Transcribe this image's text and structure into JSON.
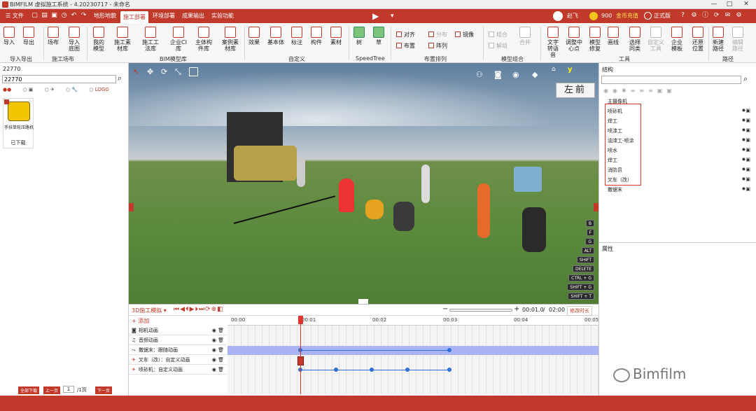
{
  "window": {
    "title": "BIMFILM 虚拟施工系统 - 4.20230717 - 未命名",
    "min": "—",
    "max": "□",
    "close": "✕"
  },
  "menu": {
    "file": "文件",
    "tabs": [
      "地形地貌",
      "施工部署",
      "环境部署",
      "成果输出",
      "实验功能"
    ],
    "active": "施工部署",
    "user": "赵飞",
    "coins": "900",
    "recharge": "金币充值",
    "edition": "正式版"
  },
  "ribbon": {
    "buttons": [
      "导入",
      "导出",
      "场布",
      "导入底图",
      "我的模型",
      "施工素材库",
      "施工工法库",
      "企业CI库",
      "主体构件库",
      "案例素材库",
      "效果",
      "基本体",
      "标注",
      "构件",
      "素材",
      "树",
      "草",
      "镜像",
      "文字转语音",
      "调整中心点",
      "模型修复",
      "画线",
      "选择同类",
      "自定义工具",
      "企业模板",
      "还原位置",
      "新建路径",
      "编辑路径"
    ],
    "small": [
      "对齐",
      "分布",
      "布置",
      "阵列",
      "组合",
      "合并",
      "解组"
    ],
    "groups": [
      "导入导出",
      "施工场布",
      "BIM模型库",
      "自定义",
      "SpeedTree",
      "布置排列",
      "模型组合",
      "工具",
      "路径"
    ]
  },
  "left": {
    "header": "22770",
    "search_value": "22770",
    "tab_logo": "LOGO",
    "item": {
      "name": "手扶单轮压路机",
      "status": "已下载"
    },
    "pager": {
      "first": "全部下载",
      "prev": "上一页",
      "page": "1",
      "total": "/1页",
      "next": "下一页"
    }
  },
  "viewport": {
    "view_labels": [
      "左",
      "前"
    ],
    "axis": "y",
    "shortcuts": [
      "B",
      "F",
      "G",
      "ALT",
      "SHIFT",
      "DELETE",
      "CTRL + G",
      "SHIFT + G",
      "SHIFT + T"
    ]
  },
  "right": {
    "structure_title": "结构",
    "root": "主摄像机",
    "items": [
      "喷砂机",
      "焊工",
      "喷漆工",
      "油漆工-喷涂",
      "喷水",
      "焊工",
      "消防员",
      "叉车（改）",
      "撒锯末"
    ],
    "properties_title": "属性"
  },
  "timeline": {
    "mode": "3D施工模拟",
    "time": "00:01.0",
    "duration": "02:00",
    "modify": "修改时长",
    "add": "添加",
    "ticks": [
      "00:00",
      "00:01",
      "00:02",
      "00:03",
      "00:04",
      "00:05"
    ],
    "tracks": [
      {
        "icon": "camera-icon",
        "label": "相机动画"
      },
      {
        "icon": "music-icon",
        "label": "音频动画"
      },
      {
        "icon": "path-icon",
        "label": "撒锯末：跟随动画"
      },
      {
        "icon": "custom-icon",
        "label": "叉车（改）：自定义动画"
      },
      {
        "icon": "custom-icon",
        "label": "喷砂机：自定义动画"
      }
    ]
  },
  "watermark": "Bimfilm",
  "colors": {
    "brand": "#c0392b",
    "highlight": "#e0342f",
    "track": "#aab4f2",
    "keyframe": "#2f6fd8"
  }
}
